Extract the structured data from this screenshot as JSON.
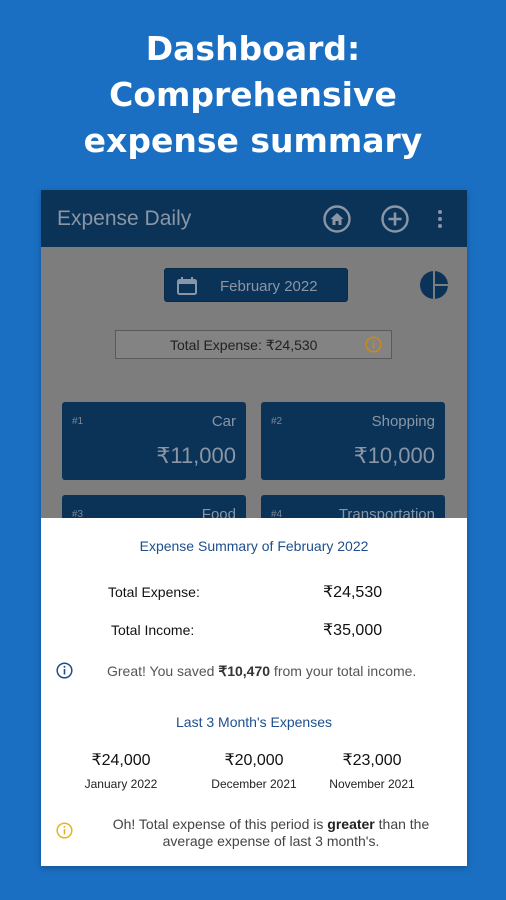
{
  "promo": {
    "line1": "Dashboard:",
    "line2": "Comprehensive",
    "line3": "expense summary"
  },
  "app_bar": {
    "title": "Expense Daily",
    "icons": [
      "home-icon",
      "add-circle-icon",
      "more-vert-icon"
    ]
  },
  "month_selector": {
    "icon": "calendar-icon",
    "label": "February  2022"
  },
  "chart_button": {
    "icon": "pie-chart-icon"
  },
  "total_expense": {
    "label": "Total Expense: ₹24,530",
    "icon": "info-icon"
  },
  "categories": [
    {
      "rank": "#1",
      "name": "Car",
      "amount": "₹11,000"
    },
    {
      "rank": "#2",
      "name": "Shopping",
      "amount": "₹10,000"
    },
    {
      "rank": "#3",
      "name": "Food",
      "amount": ""
    },
    {
      "rank": "#4",
      "name": "Transportation",
      "amount": ""
    }
  ],
  "summary": {
    "title": "Expense Summary of February 2022",
    "total_expense_label": "Total Expense:",
    "total_expense_value": "₹24,530",
    "total_income_label": "Total Income:",
    "total_income_value": "₹35,000",
    "saved_prefix": "Great! You saved ",
    "saved_amount": "₹10,470",
    "saved_suffix": " from your total income.",
    "history_title": "Last 3 Month's Expenses",
    "history": [
      {
        "amount": "₹24,000",
        "month": "January 2022"
      },
      {
        "amount": "₹20,000",
        "month": "December 2021"
      },
      {
        "amount": "₹23,000",
        "month": "November 2021"
      }
    ],
    "warning_prefix": "Oh! Total expense of this period is ",
    "warning_bold": "greater",
    "warning_suffix": " than the average expense of last 3 month's."
  },
  "colors": {
    "background": "#1a6fc2",
    "appbar": "#0b3358",
    "info_blue": "#1e4f8c",
    "warning_yellow": "#e6b422"
  }
}
